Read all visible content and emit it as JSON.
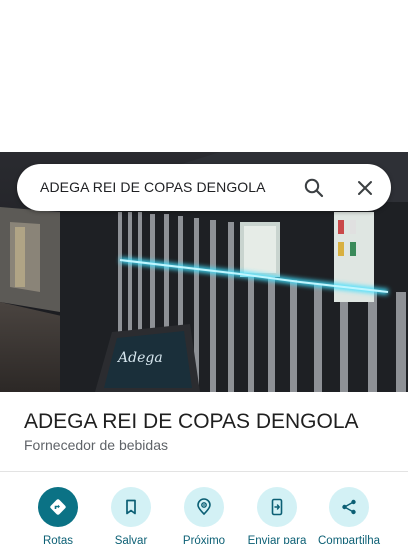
{
  "search": {
    "query": "ADEGA REI DE COPAS DENGOLA"
  },
  "place": {
    "name": "ADEGA REI DE COPAS DENGOLA",
    "category": "Fornecedor de bebidas",
    "photo_sign_text": "Adega"
  },
  "actions": [
    {
      "label": "Rotas",
      "icon": "directions-icon"
    },
    {
      "label": "Salvar",
      "icon": "bookmark-icon"
    },
    {
      "label": "Próximo",
      "icon": "nearby-icon"
    },
    {
      "label": "Enviar para",
      "icon": "send-to-phone-icon"
    },
    {
      "label": "Compartilha",
      "icon": "share-icon"
    }
  ],
  "colors": {
    "accent": "#0b7285",
    "action_bg": "#d3f1f5",
    "neon": "#3fe0ff"
  }
}
